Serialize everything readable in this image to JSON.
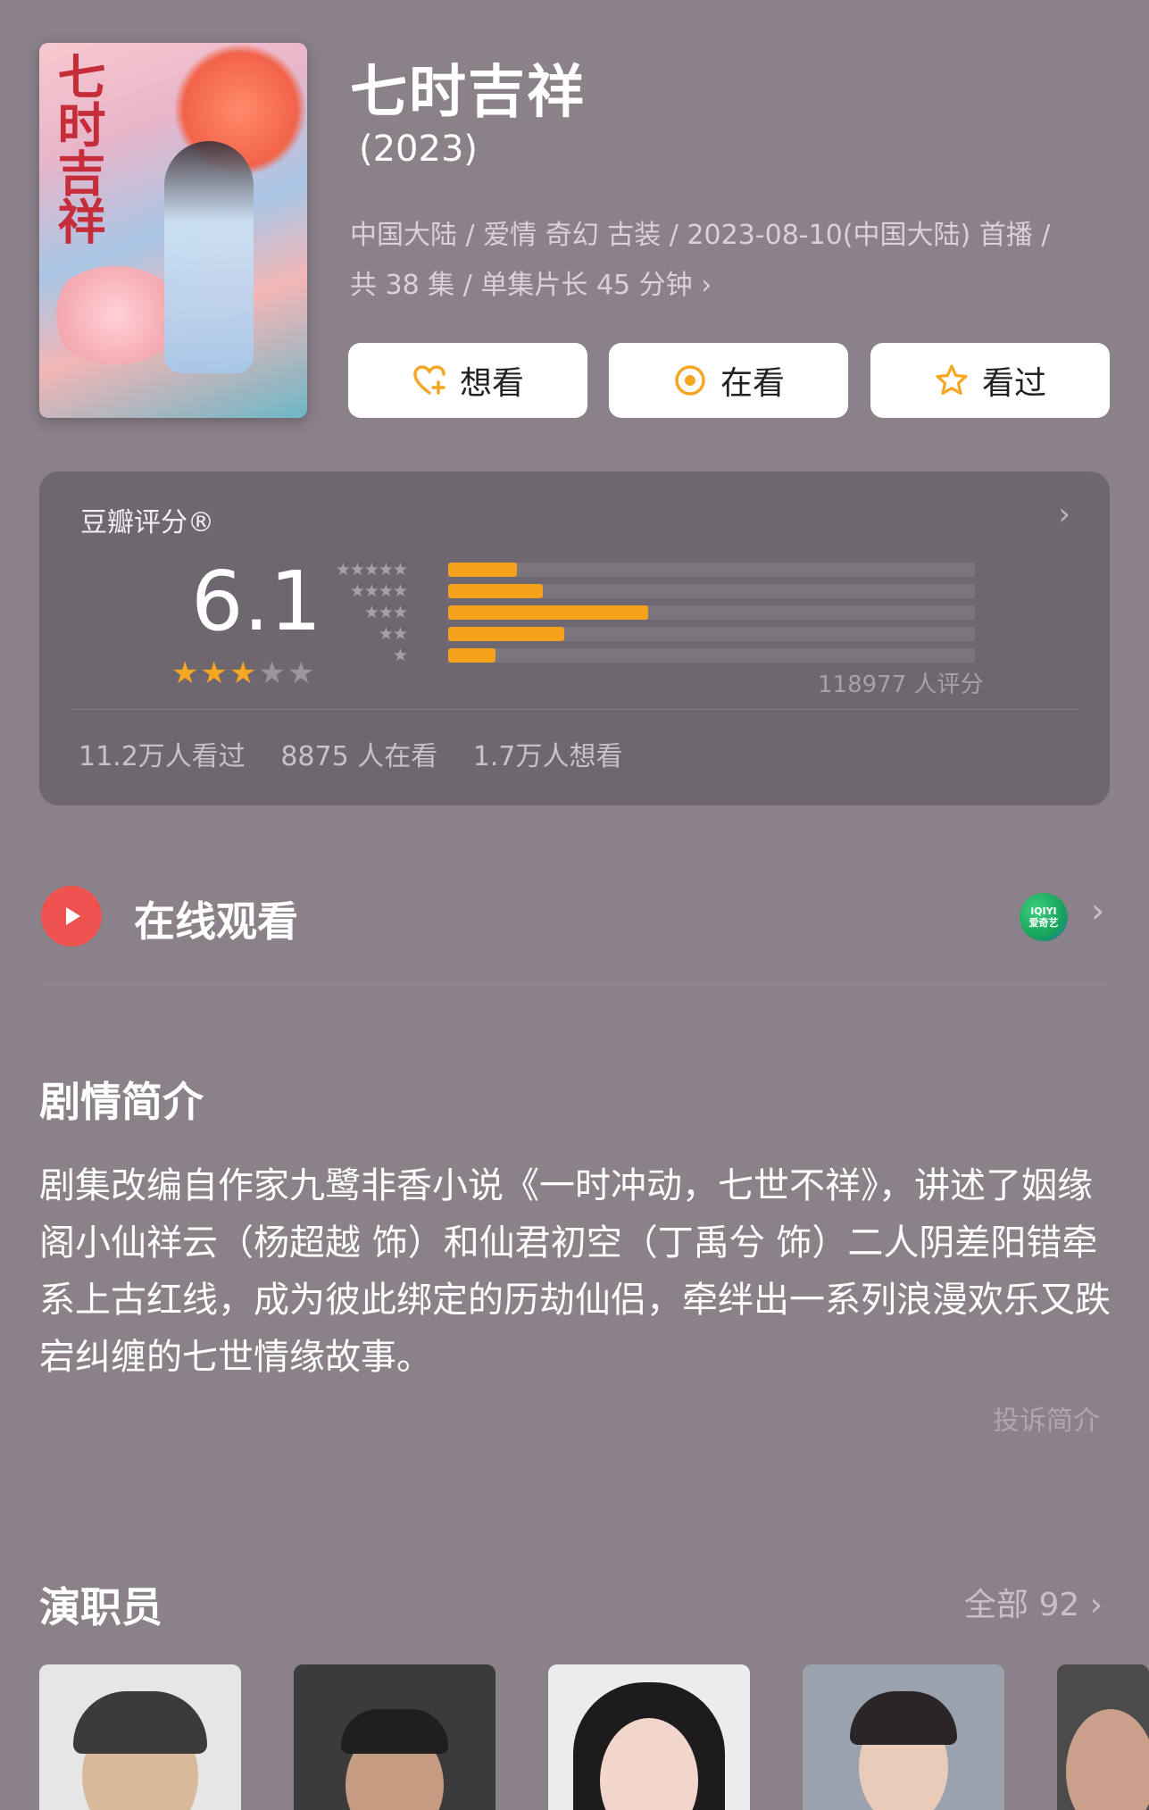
{
  "show": {
    "title": "七时吉祥",
    "year": "(2023)",
    "meta_line1": "中国大陆 / 爱情 奇幻 古装 / 2023-08-10(中国大陆) 首播 /",
    "meta_line2": "共 38 集 / 单集片长 45 分钟",
    "poster_text": "七时吉祥"
  },
  "actions": [
    {
      "label": "想看",
      "icon": "heart-plus-icon"
    },
    {
      "label": "在看",
      "icon": "target-icon"
    },
    {
      "label": "看过",
      "icon": "star-outline-icon"
    }
  ],
  "rating": {
    "label": "豆瓣评分®",
    "score": "6.1",
    "stars": 3,
    "count_text": "118977 人评分",
    "distribution": [
      {
        "stars": "★★★★★",
        "fraction": 0.13
      },
      {
        "stars": "★★★★",
        "fraction": 0.18
      },
      {
        "stars": "★★★",
        "fraction": 0.38
      },
      {
        "stars": "★★",
        "fraction": 0.22
      },
      {
        "stars": "★",
        "fraction": 0.09
      }
    ],
    "stats": [
      "11.2万人看过",
      "8875 人在看",
      "1.7万人想看"
    ]
  },
  "watch": {
    "label": "在线观看",
    "provider_top": "iQIYI",
    "provider_bottom": "爱奇艺"
  },
  "synopsis": {
    "title": "剧情简介",
    "text": "剧集改编自作家九鹭非香小说《一时冲动，七世不祥》，讲述了姻缘阁小仙祥云（杨超越 饰）和仙君初空（丁禹兮 饰）二人阴差阳错牵系上古红线，成为彼此绑定的历劫仙侣，牵绊出一系列浪漫欢乐又跌宕纠缠的七世情缘故事。",
    "report": "投诉简介"
  },
  "cast": {
    "title": "演职员",
    "all": "全部 92"
  },
  "colors": {
    "background": "#8a8189",
    "card": "#6e6770",
    "accent": "#f5a623",
    "play": "#ef5350"
  }
}
